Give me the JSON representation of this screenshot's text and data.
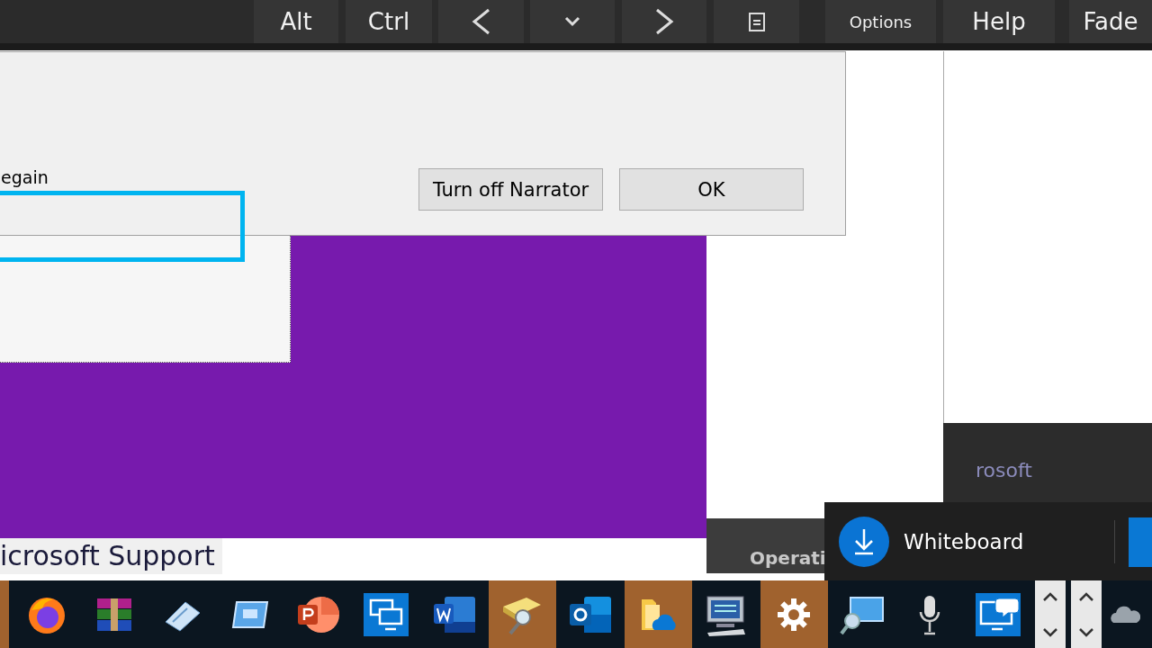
{
  "keyboard_bar": {
    "keys": [
      {
        "kind": "text",
        "label": "Alt"
      },
      {
        "kind": "text",
        "label": "Ctrl"
      },
      {
        "kind": "left"
      },
      {
        "kind": "down"
      },
      {
        "kind": "right"
      },
      {
        "kind": "clipboard"
      },
      {
        "kind": "text",
        "label": "Options"
      },
      {
        "kind": "text",
        "label": "Help"
      },
      {
        "kind": "text",
        "label": "Fade"
      }
    ]
  },
  "dialog": {
    "message": "egain",
    "buttons": [
      {
        "label": "Turn off Narrator"
      },
      {
        "label": "OK"
      }
    ]
  },
  "background_texts": {
    "support_title": "icrosoft Support",
    "side_text": "rosoft",
    "status_text": "Operati"
  },
  "notification": {
    "title": "Whiteboard"
  },
  "taskbar": {
    "items": [
      {
        "kind": "browser",
        "active": false
      },
      {
        "kind": "archive",
        "active": false
      },
      {
        "kind": "keyboard",
        "active": false
      },
      {
        "kind": "screen",
        "active": false
      },
      {
        "kind": "presentation",
        "active": false
      },
      {
        "kind": "remote",
        "active": false
      },
      {
        "kind": "document",
        "active": false
      },
      {
        "kind": "finder",
        "active": true
      },
      {
        "kind": "mail",
        "active": false
      },
      {
        "kind": "cloudfolder",
        "active": true
      },
      {
        "kind": "computer",
        "active": false
      },
      {
        "kind": "gear",
        "active": true
      },
      {
        "kind": "magnifier",
        "active": false
      },
      {
        "kind": "microphone",
        "active": false
      },
      {
        "kind": "chat",
        "active": false
      },
      {
        "kind": "chevrons",
        "active": false
      },
      {
        "kind": "chevrons",
        "active": false
      },
      {
        "kind": "cloud",
        "active": false
      }
    ]
  }
}
